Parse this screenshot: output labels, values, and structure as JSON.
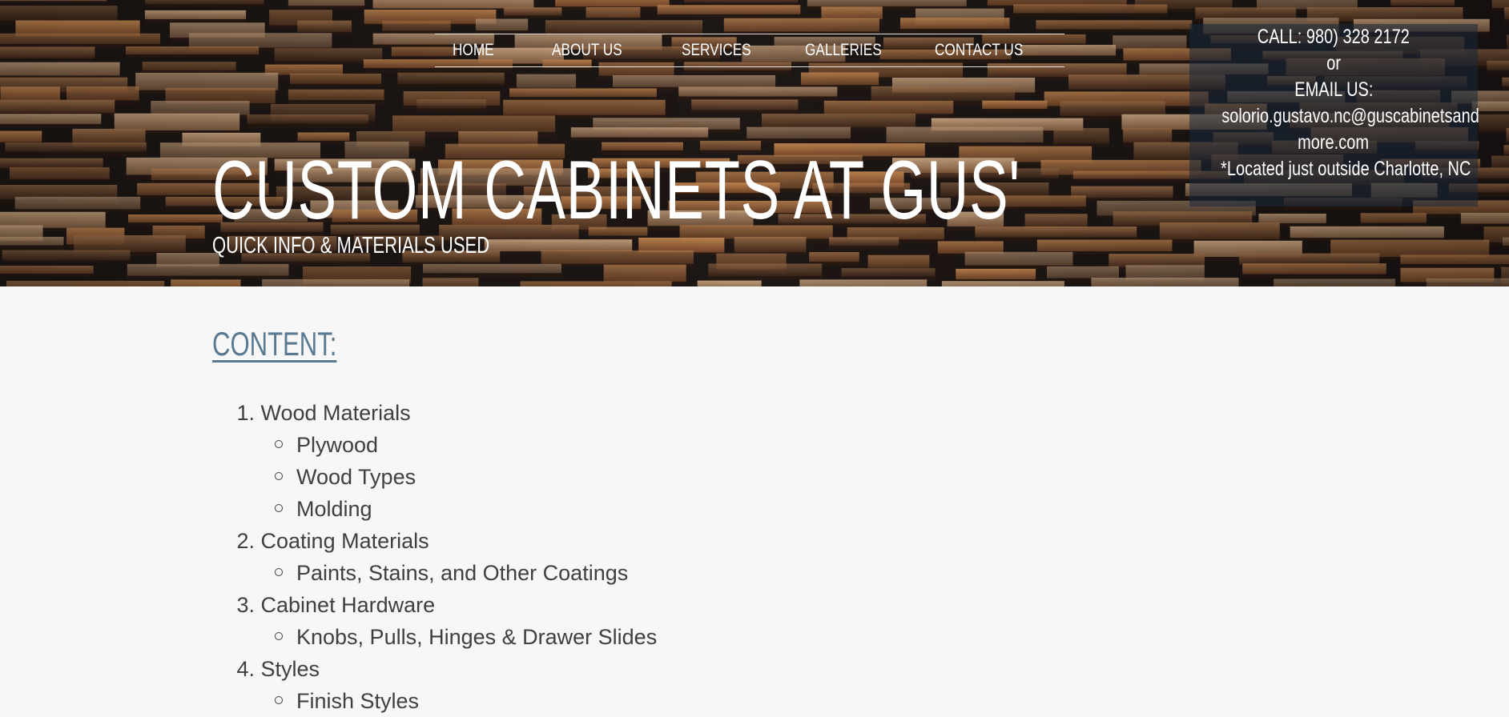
{
  "nav": {
    "items": [
      {
        "label": "HOME"
      },
      {
        "label": "ABOUT US"
      },
      {
        "label": "SERVICES"
      },
      {
        "label": "GALLERIES"
      },
      {
        "label": "CONTACT US"
      }
    ]
  },
  "contact": {
    "call": "CALL: 980) 328 2172",
    "or": "or",
    "email_label": "EMAIL US:",
    "email_line1": "solorio.gustavo.nc@guscabinetsand",
    "email_line2": "more.com",
    "location": "*Located just outside Charlotte, NC"
  },
  "hero": {
    "title": "CUSTOM CABINETS AT GUS'",
    "subtitle": "QUICK INFO & MATERIALS USED"
  },
  "content": {
    "heading": "CONTENT:",
    "items": [
      {
        "number": "1.",
        "label": "Wood Materials",
        "sub": [
          "Plywood",
          "Wood Types",
          "Molding"
        ]
      },
      {
        "number": "2.",
        "label": "Coating Materials",
        "sub": [
          "Paints, Stains, and Other Coatings"
        ]
      },
      {
        "number": "3.",
        "label": "Cabinet Hardware",
        "sub": [
          "Knobs, Pulls, Hinges & Drawer Slides"
        ]
      },
      {
        "number": "4.",
        "label": "Styles",
        "sub": [
          "Finish Styles"
        ]
      }
    ]
  },
  "colors": {
    "page_bg": "#f7f7f7",
    "heading_blue": "#5a7a92",
    "text": "#3f3f3f",
    "hero_dark": "#1e1715"
  }
}
